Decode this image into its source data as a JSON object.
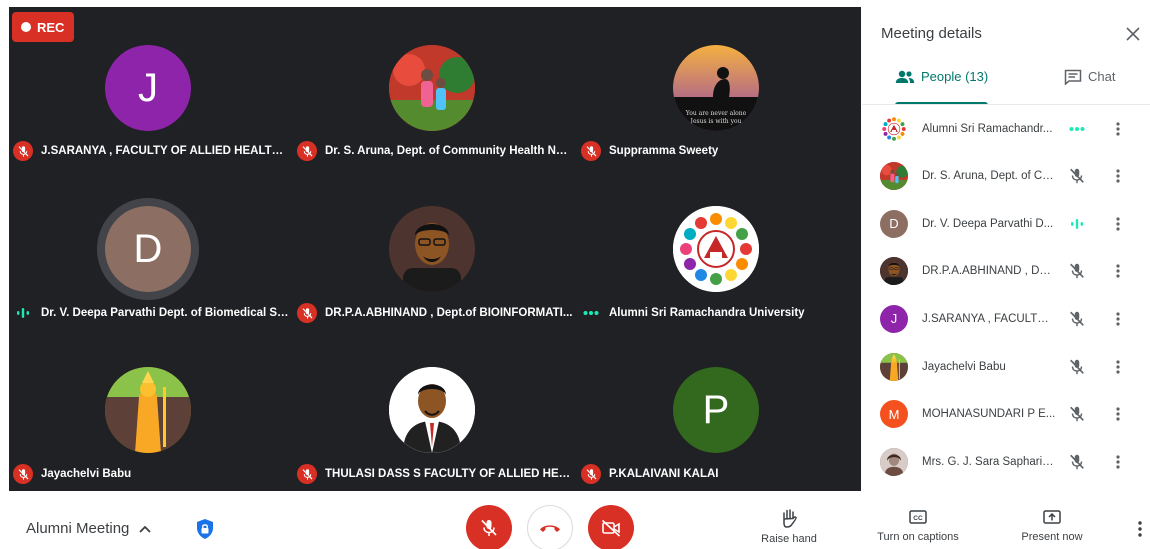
{
  "recording": {
    "label": "REC"
  },
  "tiles": [
    {
      "name": "J.SARANYA , FACULTY OF ALLIED HEALTH S...",
      "initial": "J",
      "avatar_color": "#8e24aa",
      "status": "muted"
    },
    {
      "name": "Dr. S. Aruna, Dept. of Community Health Nur...",
      "initial": "",
      "avatar_color": "#c0392b",
      "status": "muted"
    },
    {
      "name": "Suppramma Sweety",
      "initial": "",
      "avatar_color": "#222222",
      "status": "muted",
      "avatar_caption": "You are never alone Jesus is with you"
    },
    {
      "name": "Dr. V. Deepa Parvathi Dept. of Biomedical Sc...",
      "initial": "D",
      "avatar_color": "#8d6e63",
      "status": "speaking"
    },
    {
      "name": "DR.P.A.ABHINAND , Dept.of BIOINFORMATI...",
      "initial": "",
      "avatar_color": "#3e2723",
      "status": "muted"
    },
    {
      "name": "Alumni Sri Ramachandra University",
      "initial": "",
      "avatar_color": "#ffffff",
      "status": "presenting"
    },
    {
      "name": "Jayachelvi Babu",
      "initial": "",
      "avatar_color": "#b8860b",
      "status": "muted"
    },
    {
      "name": "THULASI DASS S FACULTY OF ALLIED HEAL...",
      "initial": "",
      "avatar_color": "#ffffff",
      "status": "muted"
    },
    {
      "name": "P.KALAIVANI KALAI",
      "initial": "P",
      "avatar_color": "#33691e",
      "status": "muted"
    }
  ],
  "panel": {
    "title": "Meeting details",
    "tab_people": "People (13)",
    "tab_chat": "Chat",
    "people": [
      {
        "name": "Alumni Sri Ramachandr...",
        "initial": "",
        "avatar_color": "#ffffff",
        "status": "presenting"
      },
      {
        "name": "Dr. S. Aruna, Dept. of Co...",
        "initial": "",
        "avatar_color": "#c0392b",
        "status": "muted"
      },
      {
        "name": "Dr. V. Deepa Parvathi D...",
        "initial": "D",
        "avatar_color": "#8d6e63",
        "status": "speaking"
      },
      {
        "name": "DR.P.A.ABHINAND , Dep...",
        "initial": "",
        "avatar_color": "#3e2723",
        "status": "muted"
      },
      {
        "name": "J.SARANYA , FACULTY ...",
        "initial": "J",
        "avatar_color": "#8e24aa",
        "status": "muted"
      },
      {
        "name": "Jayachelvi Babu",
        "initial": "",
        "avatar_color": "#b8860b",
        "status": "muted"
      },
      {
        "name": "MOHANASUNDARI P E...",
        "initial": "M",
        "avatar_color": "#f4511e",
        "status": "muted"
      },
      {
        "name": "Mrs. G. J. Sara Sapharin...",
        "initial": "",
        "avatar_color": "#6d4c41",
        "status": "muted"
      }
    ]
  },
  "bottom": {
    "meeting_name": "Alumni Meeting",
    "raise_hand": "Raise hand",
    "captions": "Turn on captions",
    "present": "Present now"
  },
  "colors": {
    "accent": "#00796b",
    "danger": "#d93025",
    "grid_bg": "#202124",
    "speaking": "#1de9b6"
  }
}
